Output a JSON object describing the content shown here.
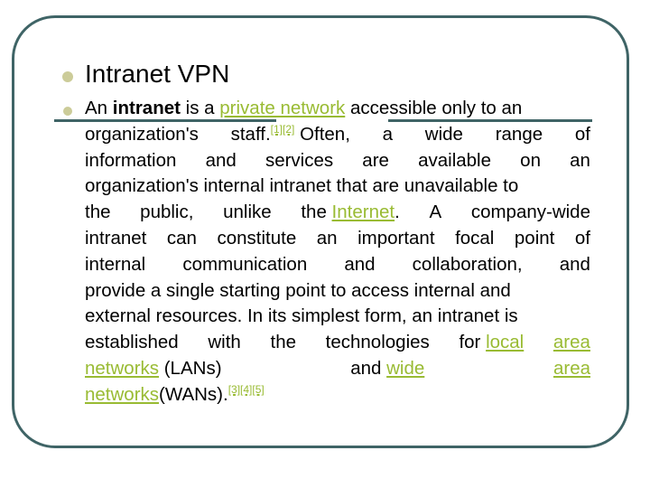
{
  "slide": {
    "title": "Intranet VPN",
    "paragraph": {
      "t1": "An ",
      "t2_bold": "intranet",
      "t3": " is a ",
      "link_private_network": "private network",
      "t4": " accessible only to an",
      "line2_a": "organization's",
      "line2_b": "staff.",
      "ref_1_2": "[1][2]",
      "line2_c": "Often,",
      "line2_d": "a",
      "line2_e": "wide",
      "line2_f": "range",
      "line2_g": "of",
      "line3": [
        "information",
        "and",
        "services",
        "are",
        "available",
        "on",
        "an"
      ],
      "line4": "organization's internal intranet that are unavailable to",
      "line5_a": "the",
      "line5_b": "public,",
      "line5_c": "unlike",
      "line5_d": "the",
      "link_internet": "Internet",
      "line5_e": ".",
      "line5_f": "A",
      "line5_g": "company-wide",
      "line6": [
        "intranet",
        "can",
        "constitute",
        "an",
        "important",
        "focal",
        "point",
        "of"
      ],
      "line7": [
        "internal",
        "communication",
        "and",
        "collaboration,",
        "and"
      ],
      "line8": "provide a single starting point to access internal and",
      "line9": "external resources. In its simplest form, an intranet is",
      "line10": [
        "established",
        "with",
        "the",
        "technologies",
        "for"
      ],
      "link_local": "local",
      "link_area1": "area",
      "link_networks1": "networks",
      "line11_a": "(LANs)",
      "line11_b": "and",
      "link_wide": "wide",
      "link_area2": "area",
      "link_networks2": "networks",
      "line12_a": "(WANs).",
      "ref_3_4_5": "[3][4][5]"
    }
  },
  "colors": {
    "frame": "#3f6466",
    "bullet": "#cccc99",
    "link": "#99bb33"
  }
}
